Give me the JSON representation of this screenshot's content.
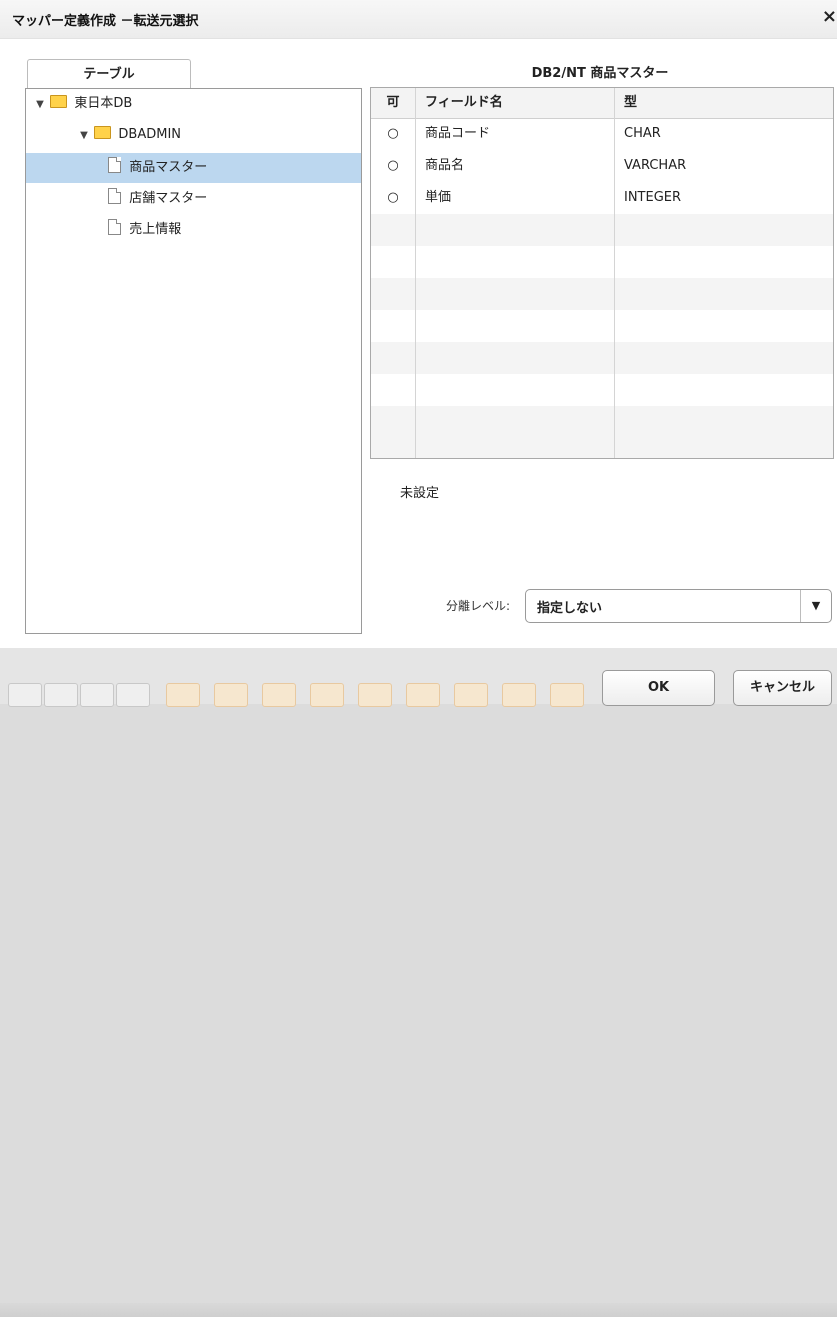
{
  "dialog": {
    "title": "マッパー定義作成 －転送元選択",
    "close_glyph": "×"
  },
  "tree": {
    "tab_label": "テーブル",
    "items": [
      {
        "label": "東日本DB",
        "level": 0,
        "type": "folder",
        "expanded": true,
        "selected": false
      },
      {
        "label": "DBADMIN",
        "level": 1,
        "type": "folder",
        "expanded": true,
        "selected": false
      },
      {
        "label": "商品マスター",
        "level": 2,
        "type": "table",
        "selected": true
      },
      {
        "label": "店舗マスター",
        "level": 2,
        "type": "table",
        "selected": false
      },
      {
        "label": "売上情報",
        "level": 2,
        "type": "table",
        "selected": false
      }
    ]
  },
  "grid": {
    "title": "DB2/NT 商品マスター",
    "columns": [
      "可",
      "フィールド名",
      "型"
    ],
    "rows": [
      [
        "○",
        "商品コード",
        "CHAR"
      ],
      [
        "○",
        "商品名",
        "VARCHAR"
      ],
      [
        "○",
        "単価",
        "INTEGER"
      ]
    ]
  },
  "status_text": "未設定",
  "isolation": {
    "label": "分離レベル:",
    "value": "指定しない",
    "arrow_glyph": "▼"
  },
  "buttons": {
    "ok": "OK",
    "cancel": "キャンセル"
  },
  "colors": {
    "selection": "#bcd7ef",
    "folder": "#ffd24a"
  }
}
